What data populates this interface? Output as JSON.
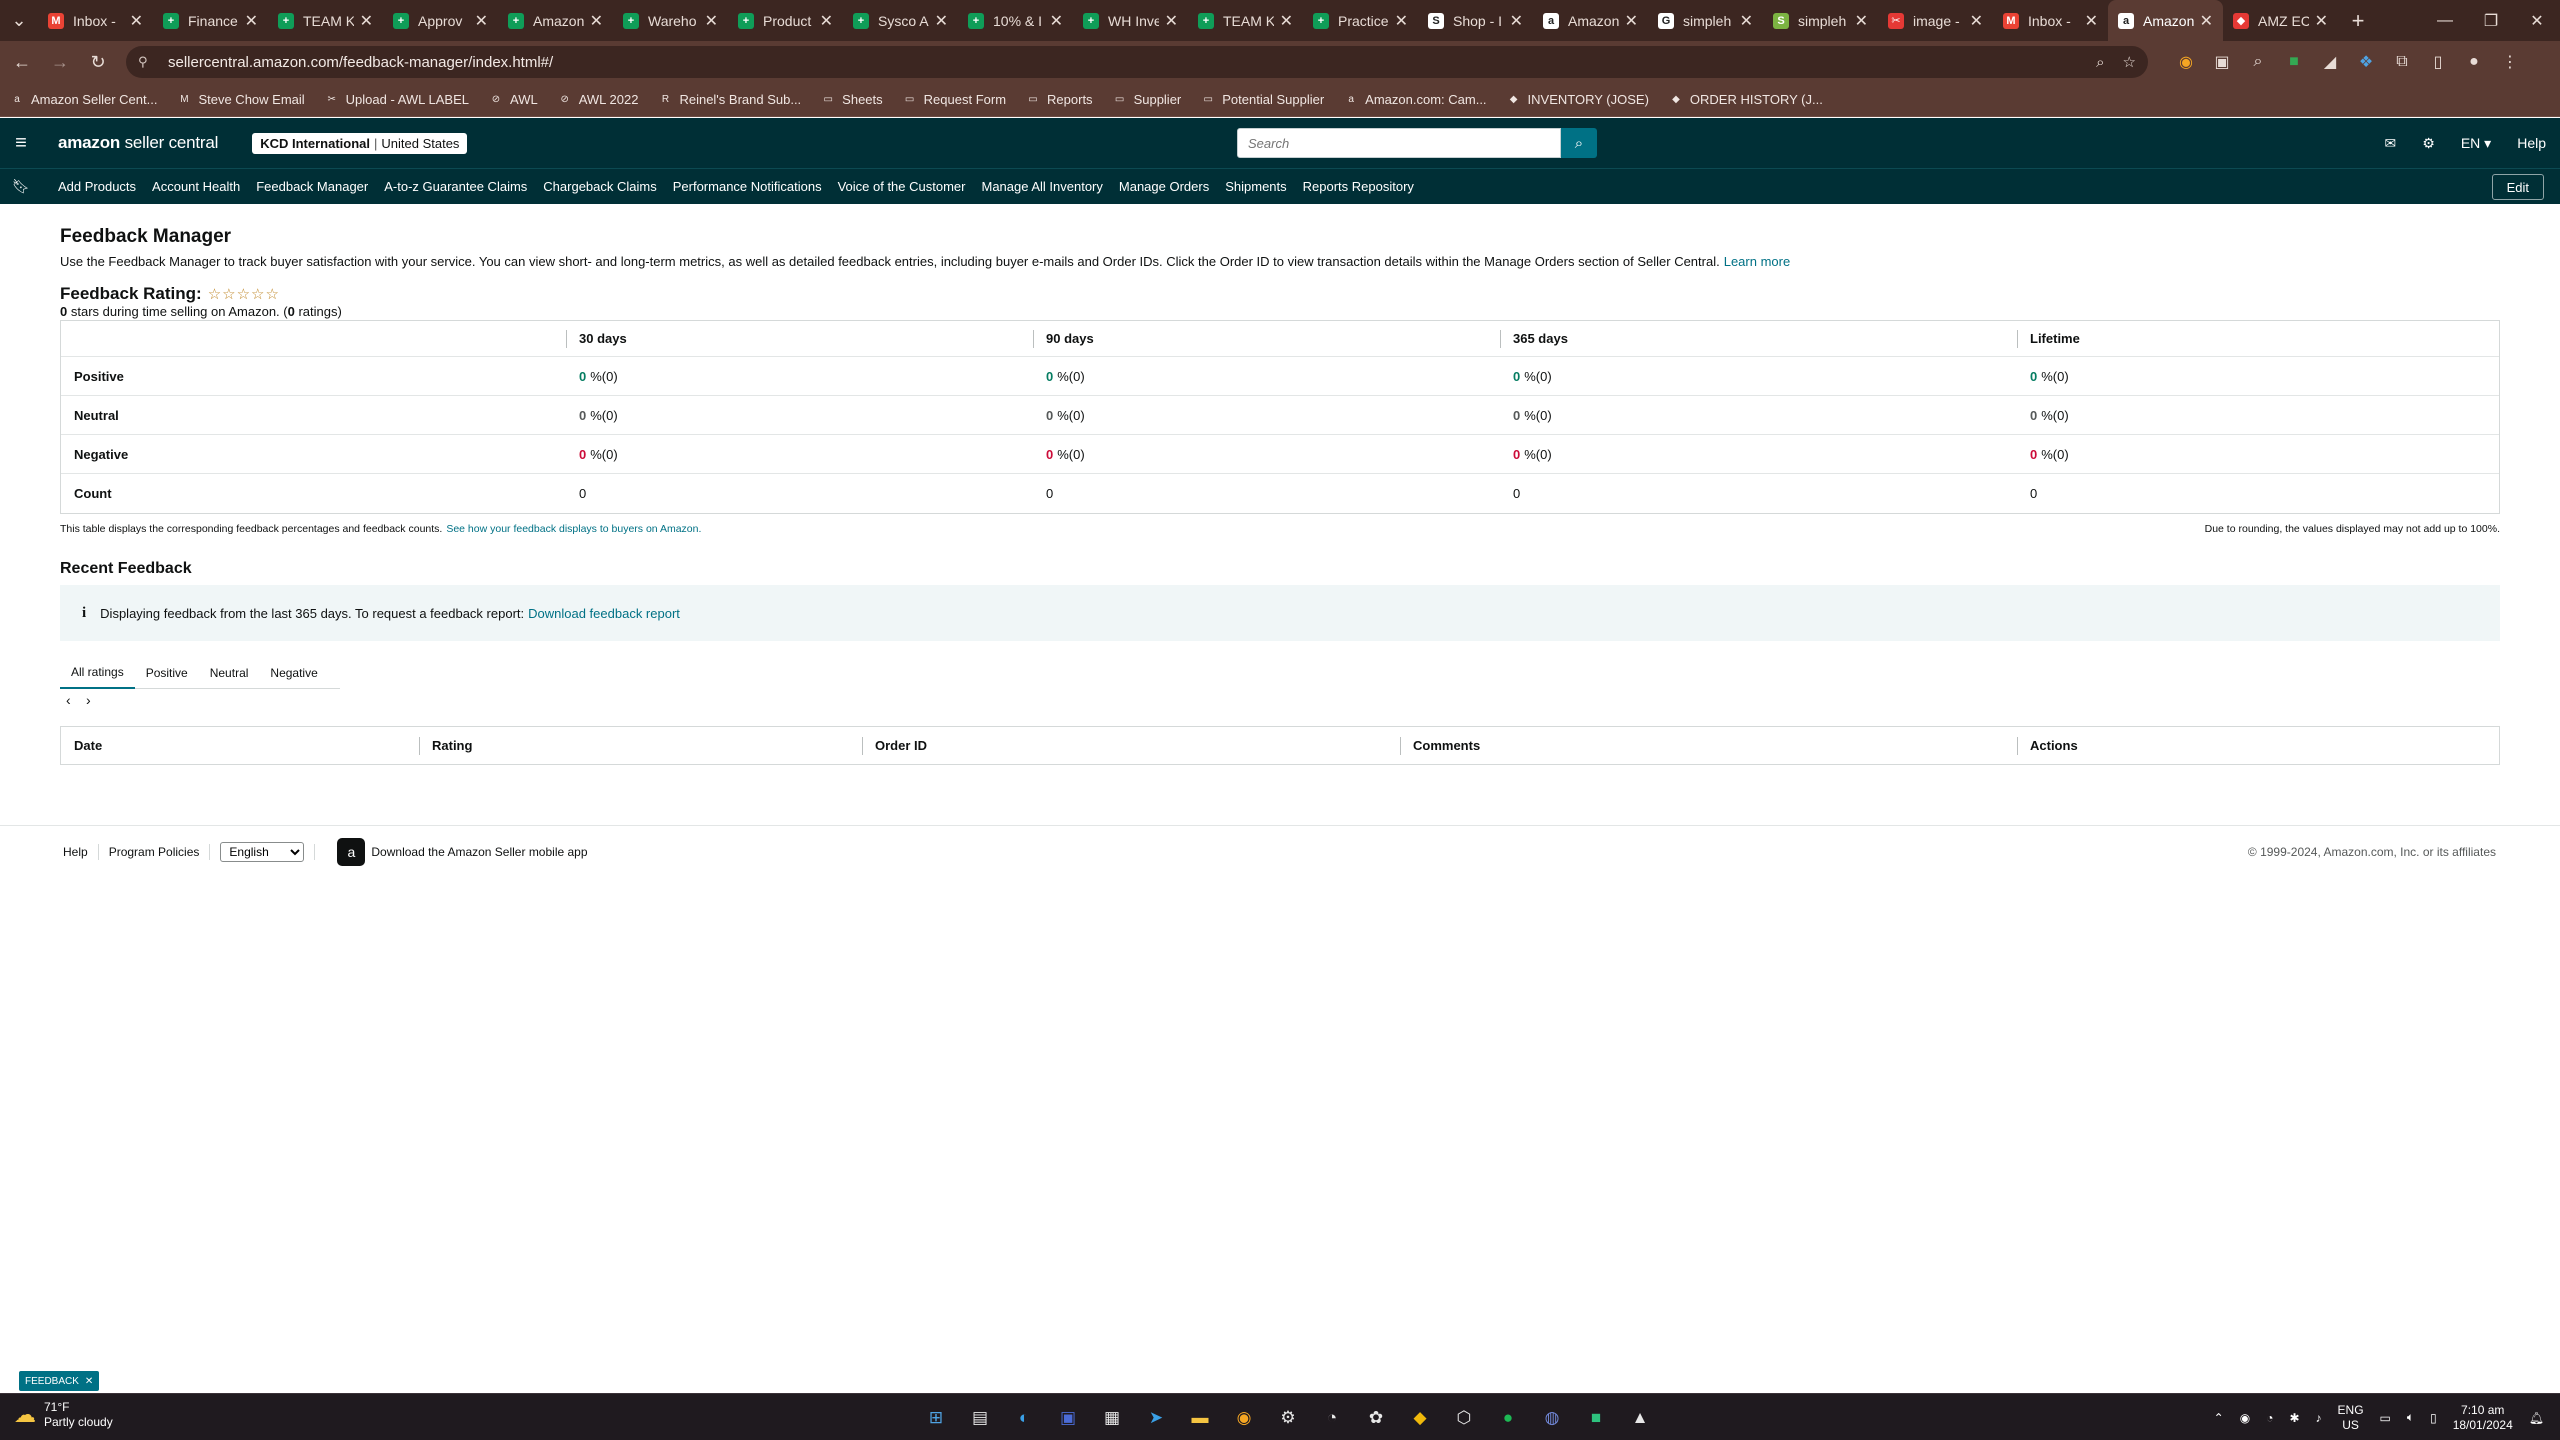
{
  "browser": {
    "tabs": [
      {
        "label": "Inbox -",
        "fav": "M",
        "color": "#ea4335"
      },
      {
        "label": "Finance",
        "fav": "+",
        "color": "#0f9d58"
      },
      {
        "label": "TEAM K",
        "fav": "+",
        "color": "#0f9d58"
      },
      {
        "label": "Approv",
        "fav": "+",
        "color": "#0f9d58"
      },
      {
        "label": "Amazon",
        "fav": "+",
        "color": "#0f9d58"
      },
      {
        "label": "Wareho",
        "fav": "+",
        "color": "#0f9d58"
      },
      {
        "label": "Product",
        "fav": "+",
        "color": "#0f9d58"
      },
      {
        "label": "Sysco A",
        "fav": "+",
        "color": "#0f9d58"
      },
      {
        "label": "10% & I",
        "fav": "+",
        "color": "#0f9d58"
      },
      {
        "label": "WH Inve",
        "fav": "+",
        "color": "#0f9d58"
      },
      {
        "label": "TEAM K",
        "fav": "+",
        "color": "#0f9d58"
      },
      {
        "label": "Practice",
        "fav": "+",
        "color": "#0f9d58"
      },
      {
        "label": "Shop - I",
        "fav": "S",
        "color": "#ffffff"
      },
      {
        "label": "Amazon",
        "fav": "a",
        "color": "#ffffff"
      },
      {
        "label": "simpleh",
        "fav": "G",
        "color": "#ffffff"
      },
      {
        "label": "simpleh",
        "fav": "S",
        "color": "#7cb342"
      },
      {
        "label": "image -",
        "fav": "✂",
        "color": "#e53935"
      },
      {
        "label": "Inbox -",
        "fav": "M",
        "color": "#ea4335"
      },
      {
        "label": "Amazon",
        "fav": "a",
        "color": "#ffffff",
        "active": true
      },
      {
        "label": "AMZ EC",
        "fav": "◆",
        "color": "#e53935"
      }
    ],
    "url": "sellercentral.amazon.com/feedback-manager/index.html#/",
    "bookmarks": [
      {
        "label": "Amazon Seller Cent...",
        "icon": "a"
      },
      {
        "label": "Steve Chow Email",
        "icon": "M"
      },
      {
        "label": "Upload - AWL LABEL",
        "icon": "✂"
      },
      {
        "label": "AWL",
        "icon": "⊘"
      },
      {
        "label": "AWL 2022",
        "icon": "⊘"
      },
      {
        "label": "Reinel's Brand Sub...",
        "icon": "R"
      },
      {
        "label": "Sheets",
        "icon": "▭"
      },
      {
        "label": "Request Form",
        "icon": "▭"
      },
      {
        "label": "Reports",
        "icon": "▭"
      },
      {
        "label": "Supplier",
        "icon": "▭"
      },
      {
        "label": "Potential Supplier",
        "icon": "▭"
      },
      {
        "label": "Amazon.com: Cam...",
        "icon": "a"
      },
      {
        "label": "INVENTORY (JOSE)",
        "icon": "◆"
      },
      {
        "label": "ORDER HISTORY (J...",
        "icon": "◆"
      }
    ]
  },
  "header": {
    "logo_main": "amazon",
    "logo_rest": " seller central",
    "store_name": "KCD International",
    "store_region": "United States",
    "search_placeholder": "Search",
    "lang": "EN ▾",
    "help": "Help"
  },
  "nav": {
    "links": [
      "Add Products",
      "Account Health",
      "Feedback Manager",
      "A-to-z Guarantee Claims",
      "Chargeback Claims",
      "Performance Notifications",
      "Voice of the Customer",
      "Manage All Inventory",
      "Manage Orders",
      "Shipments",
      "Reports Repository"
    ],
    "edit": "Edit"
  },
  "page": {
    "title": "Feedback Manager",
    "description": "Use the Feedback Manager to track buyer satisfaction with your service. You can view short- and long-term metrics, as well as detailed feedback entries, including buyer e-mails and Order IDs. Click the Order ID to view transaction details within the Manage Orders section of Seller Central.",
    "learn_more": "Learn more",
    "rating_label": "Feedback Rating:",
    "stars": "☆☆☆☆☆",
    "stars_value": "0",
    "rating_sub_text": " stars during time selling on Amazon. (",
    "ratings_count": "0",
    "ratings_suffix": " ratings)"
  },
  "feedback_table": {
    "columns": [
      "",
      "30 days",
      "90 days",
      "365 days",
      "Lifetime"
    ],
    "rows": [
      {
        "label": "Positive",
        "kind": "pos",
        "cells": [
          [
            "0",
            "%(0)"
          ],
          [
            "0",
            "%(0)"
          ],
          [
            "0",
            "%(0)"
          ],
          [
            "0",
            "%(0)"
          ]
        ]
      },
      {
        "label": "Neutral",
        "kind": "neu",
        "cells": [
          [
            "0",
            "%(0)"
          ],
          [
            "0",
            "%(0)"
          ],
          [
            "0",
            "%(0)"
          ],
          [
            "0",
            "%(0)"
          ]
        ]
      },
      {
        "label": "Negative",
        "kind": "negv",
        "cells": [
          [
            "0",
            "%(0)"
          ],
          [
            "0",
            "%(0)"
          ],
          [
            "0",
            "%(0)"
          ],
          [
            "0",
            "%(0)"
          ]
        ]
      },
      {
        "label": "Count",
        "kind": "count",
        "cells": [
          [
            "",
            "0"
          ],
          [
            "",
            "0"
          ],
          [
            "",
            "0"
          ],
          [
            "",
            "0"
          ]
        ]
      }
    ],
    "note": "This table displays the corresponding feedback percentages and feedback counts.",
    "note_link": "See how your feedback displays to buyers on Amazon.",
    "rounding_note": "Due to rounding, the values displayed may not add up to 100%."
  },
  "recent": {
    "title": "Recent Feedback",
    "info_text": "Displaying feedback from the last 365 days. To request a feedback report:",
    "info_link": "Download feedback report",
    "tabs": [
      "All ratings",
      "Positive",
      "Neutral",
      "Negative"
    ],
    "columns": [
      "Date",
      "Rating",
      "Order ID",
      "Comments",
      "Actions"
    ]
  },
  "footer": {
    "help": "Help",
    "policies": "Program Policies",
    "language": "English",
    "app_text": "Download the Amazon Seller mobile app",
    "copyright": "© 1999-2024, Amazon.com, Inc. or its affiliates"
  },
  "feedback_tag": "FEEDBACK",
  "taskbar": {
    "temp": "71°F",
    "condition": "Partly cloudy",
    "lang_1": "ENG",
    "lang_2": "US",
    "time": "7:10 am",
    "date": "18/01/2024"
  }
}
